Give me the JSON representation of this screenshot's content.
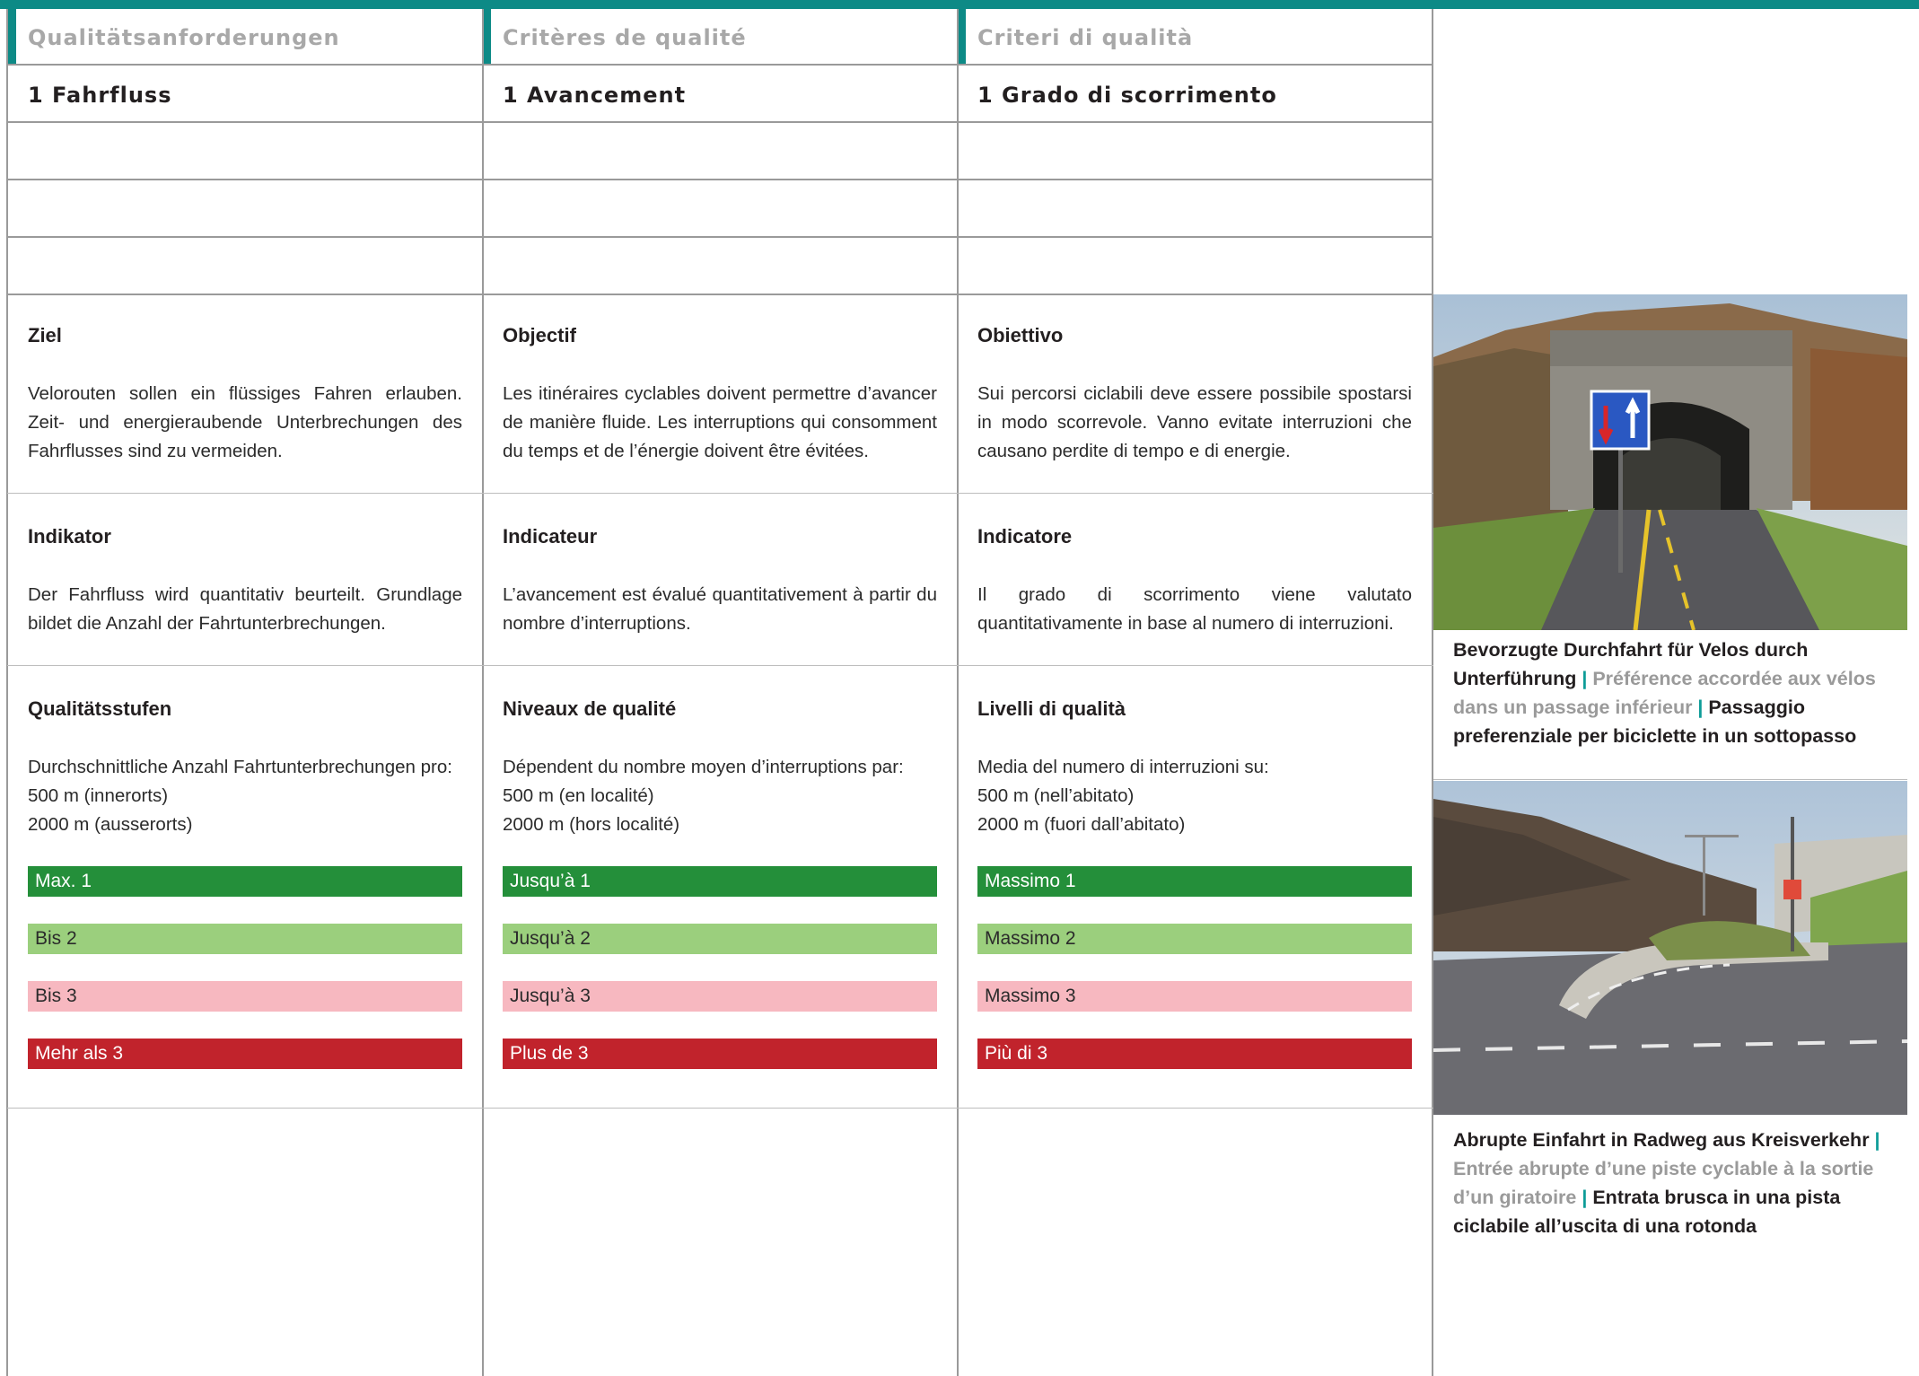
{
  "columns": [
    {
      "header": "Qualitätsanforderungen",
      "section": "1 Fahrfluss",
      "goal_title": "Ziel",
      "goal_text": "Velorouten sollen ein flüssiges Fahren erlauben. Zeit- und energieraubende Unterbrechungen des Fahrflusses sind zu vermeiden.",
      "indicator_title": "Indikator",
      "indicator_text": "Der Fahrfluss wird quantitativ beurteilt. Grundlage bildet die Anzahl der Fahrtunterbrechungen.",
      "levels_title": "Qualitätsstufen",
      "levels_intro": "Durchschnittliche Anzahl Fahrtunterbrechungen pro:",
      "levels_line1": "500 m (innerorts)",
      "levels_line2": "2000 m (ausserorts)",
      "levels": [
        "Max. 1",
        "Bis 2",
        "Bis 3",
        "Mehr als 3"
      ]
    },
    {
      "header": "Critères de qualité",
      "section": "1 Avancement",
      "goal_title": "Objectif",
      "goal_text": "Les itinéraires cyclables doivent permettre d’avancer de manière fluide. Les interruptions qui consomment du temps et de l’énergie doivent être évitées.",
      "indicator_title": "Indicateur",
      "indicator_text": "L’avancement est évalué quantitativement à partir du nombre d’interruptions.",
      "levels_title": "Niveaux de qualité",
      "levels_intro": "Dépendent du nombre moyen d’interruptions par:",
      "levels_line1": "500 m (en localité)",
      "levels_line2": "2000 m (hors localité)",
      "levels": [
        "Jusqu’à 1",
        "Jusqu’à 2",
        "Jusqu’à 3",
        "Plus de 3"
      ]
    },
    {
      "header": "Criteri di qualità",
      "section": "1 Grado di scorrimento",
      "goal_title": "Obiettivo",
      "goal_text": "Sui percorsi ciclabili deve essere possibile spostarsi in modo scorrevole. Vanno evitate interruzioni che causano perdite di tempo e di energie.",
      "indicator_title": "Indicatore",
      "indicator_text": "Il grado di scorrimento viene valutato quantitativamente in base al numero di interruzioni.",
      "levels_title": "Livelli di qualità",
      "levels_intro": "Media del numero di interruzioni su:",
      "levels_line1": "500 m (nell’abitato)",
      "levels_line2": "2000 m (fuori dall’abitato)",
      "levels": [
        "Massimo 1",
        "Massimo 2",
        "Massimo 3",
        "Più di 3"
      ]
    }
  ],
  "captions": [
    {
      "de": "Bevorzugte Durchfahrt für Velos durch Unterführung",
      "sep1": " | ",
      "fr": "Préférence accordée aux vélos dans un passage inférieur",
      "sep2": " | ",
      "it": "Passaggio preferenziale per biciclette in un sottopasso"
    },
    {
      "de": "Abrupte Einfahrt in Radweg aus Kreisverkehr",
      "sep1": " | ",
      "fr": "Entrée abrupte d’une piste cyclable à la sortie d’un giratoire",
      "sep2": " | ",
      "it": "Entrata brusca in una pista ciclabile all’uscita di una rotonda"
    }
  ],
  "colors": {
    "accent": "#0d8a86",
    "level1": "#248f3a",
    "level2": "#9bcf7d",
    "level3": "#f7b8c0",
    "level4": "#c1232c"
  }
}
